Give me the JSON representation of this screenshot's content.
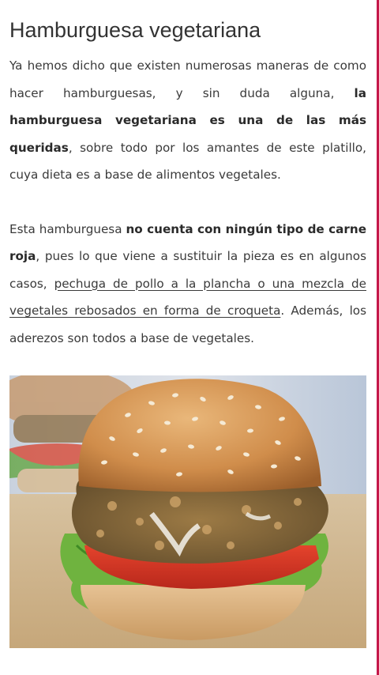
{
  "article": {
    "title": "Hamburguesa vegetariana",
    "paragraph1": {
      "t1": "Ya hemos dicho que existen numerosas maneras de como hacer hamburguesas, y sin duda alguna, ",
      "b1": "la hamburguesa vegetariana es una de las más queridas",
      "t2": ", sobre todo por los amantes de este platillo, cuya dieta es a base de alimentos vegetales."
    },
    "paragraph2": {
      "t1": "Esta hamburguesa ",
      "b1": "no cuenta con ningún tipo de carne roja",
      "t2": ", pues lo que viene a sustituir la pieza es en algunos casos, ",
      "link": "pechuga de pollo a la plancha o una mezcla de vegetales rebosados en forma de croqueta",
      "t3": ". Además, los aderezos son todos a base de vegetales."
    },
    "image": {
      "subject": "veggie-burger-photo"
    }
  },
  "colors": {
    "accent_bar": "#c4184a",
    "text": "#3a3a3a",
    "background": "#ffffff"
  }
}
